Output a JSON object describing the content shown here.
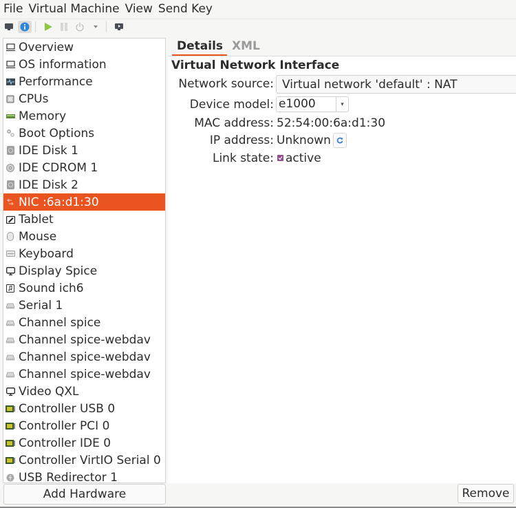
{
  "menubar": {
    "items": [
      "File",
      "Virtual Machine",
      "View",
      "Send Key"
    ]
  },
  "toolbar": {
    "buttons": [
      {
        "name": "console",
        "icon": "monitor-icon"
      },
      {
        "name": "details",
        "icon": "info-icon",
        "active": true
      },
      {
        "name": "run",
        "icon": "play-icon"
      },
      {
        "name": "pause",
        "icon": "pause-icon"
      },
      {
        "name": "shutdown",
        "icon": "power-icon"
      },
      {
        "name": "shutdown-menu",
        "icon": "chevron-down-icon"
      },
      {
        "name": "fullscreen",
        "icon": "screen-icon"
      }
    ]
  },
  "sidebar": {
    "items": [
      {
        "label": "Overview",
        "icon": "monitor-icon"
      },
      {
        "label": "OS information",
        "icon": "monitor-icon"
      },
      {
        "label": "Performance",
        "icon": "performance-icon"
      },
      {
        "label": "CPUs",
        "icon": "cpu-icon"
      },
      {
        "label": "Memory",
        "icon": "memory-icon"
      },
      {
        "label": "Boot Options",
        "icon": "boot-icon"
      },
      {
        "label": "IDE Disk 1",
        "icon": "disk-icon"
      },
      {
        "label": "IDE CDROM 1",
        "icon": "cdrom-icon"
      },
      {
        "label": "IDE Disk 2",
        "icon": "disk-icon"
      },
      {
        "label": "NIC :6a:d1:30",
        "icon": "network-icon",
        "selected": true
      },
      {
        "label": "Tablet",
        "icon": "tablet-icon"
      },
      {
        "label": "Mouse",
        "icon": "mouse-icon"
      },
      {
        "label": "Keyboard",
        "icon": "keyboard-icon"
      },
      {
        "label": "Display Spice",
        "icon": "display-icon"
      },
      {
        "label": "Sound ich6",
        "icon": "sound-icon"
      },
      {
        "label": "Serial 1",
        "icon": "serial-icon"
      },
      {
        "label": "Channel spice",
        "icon": "serial-icon"
      },
      {
        "label": "Channel spice-webdav",
        "icon": "serial-icon"
      },
      {
        "label": "Channel spice-webdav",
        "icon": "serial-icon"
      },
      {
        "label": "Channel spice-webdav",
        "icon": "serial-icon"
      },
      {
        "label": "Video QXL",
        "icon": "display-icon"
      },
      {
        "label": "Controller USB 0",
        "icon": "controller-icon"
      },
      {
        "label": "Controller PCI 0",
        "icon": "controller-icon"
      },
      {
        "label": "Controller IDE 0",
        "icon": "controller-icon"
      },
      {
        "label": "Controller VirtIO Serial 0",
        "icon": "controller-icon"
      },
      {
        "label": "USB Redirector 1",
        "icon": "usb-icon"
      }
    ],
    "add_hardware_label": "Add Hardware"
  },
  "tabs": {
    "details": "Details",
    "xml": "XML"
  },
  "details": {
    "title": "Virtual Network Interface",
    "network_source_label": "Network source:",
    "network_source_value": "Virtual network 'default' : NAT",
    "device_model_label": "Device model:",
    "device_model_value": "e1000",
    "mac_label": "MAC address:",
    "mac_value": "52:54:00:6a:d1:30",
    "ip_label": "IP address:",
    "ip_value": "Unknown",
    "link_state_label": "Link state:",
    "link_state_value": "active",
    "link_state_checked": true
  },
  "footer": {
    "remove_label": "Remove"
  },
  "colors": {
    "accent": "#e95420",
    "checkbox": "#924d8b"
  }
}
